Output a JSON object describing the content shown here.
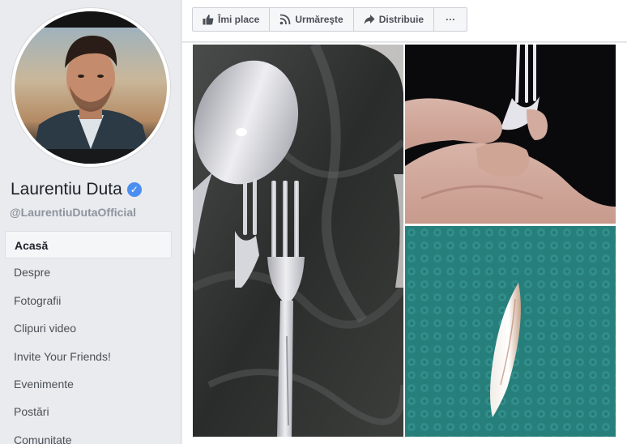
{
  "profile": {
    "name": "Laurentiu Duta",
    "handle": "@LaurentiuDutaOfficial",
    "verified": true,
    "verified_icon": "verified-badge-icon"
  },
  "nav": {
    "items": [
      {
        "label": "Acasă",
        "active": true
      },
      {
        "label": "Despre",
        "active": false
      },
      {
        "label": "Fotografii",
        "active": false
      },
      {
        "label": "Clipuri video",
        "active": false
      },
      {
        "label": "Invite Your Friends!",
        "active": false
      },
      {
        "label": "Evenimente",
        "active": false
      },
      {
        "label": "Postări",
        "active": false
      },
      {
        "label": "Comunitate",
        "active": false
      }
    ]
  },
  "actions": {
    "like_label": "Îmi place",
    "follow_label": "Urmăreşte",
    "share_label": "Distribuie",
    "more_label": "···"
  },
  "colors": {
    "page_bg": "#e9ebee",
    "verified_blue": "#4b8ef0",
    "text_primary": "#1d2129",
    "text_secondary": "#8d949e"
  },
  "photos": [
    {
      "subject": "plastic spoon and fork on dark plastic bag"
    },
    {
      "subject": "hand holding plastic fork"
    },
    {
      "subject": "white plastic shard on teal towel"
    }
  ]
}
